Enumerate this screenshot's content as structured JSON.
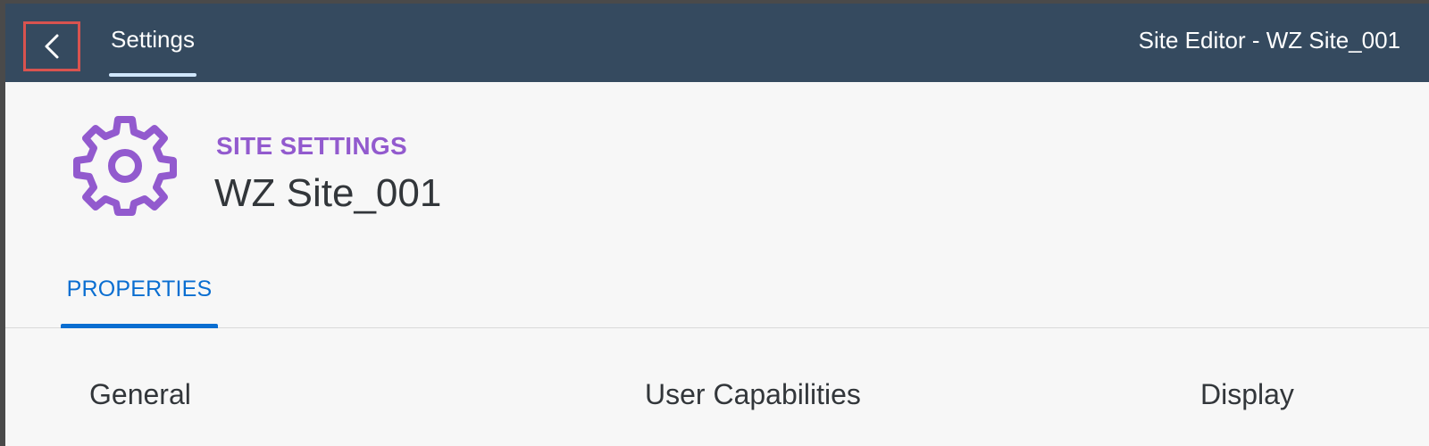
{
  "shellbar": {
    "back_icon": "chevron-left-icon",
    "tab_label": "Settings",
    "title": "Site Editor - WZ Site_001"
  },
  "object_header": {
    "icon": "gear-icon",
    "subtitle": "SITE SETTINGS",
    "title": "WZ Site_001"
  },
  "tabs": [
    {
      "label": "PROPERTIES",
      "selected": true
    }
  ],
  "sections": [
    {
      "label": "General"
    },
    {
      "label": "User Capabilities"
    },
    {
      "label": "Display"
    }
  ],
  "colors": {
    "shellbar": "#354a5f",
    "accent_purple": "#925ace",
    "accent_blue": "#0a6ed1",
    "highlight_border": "#d9534f"
  }
}
